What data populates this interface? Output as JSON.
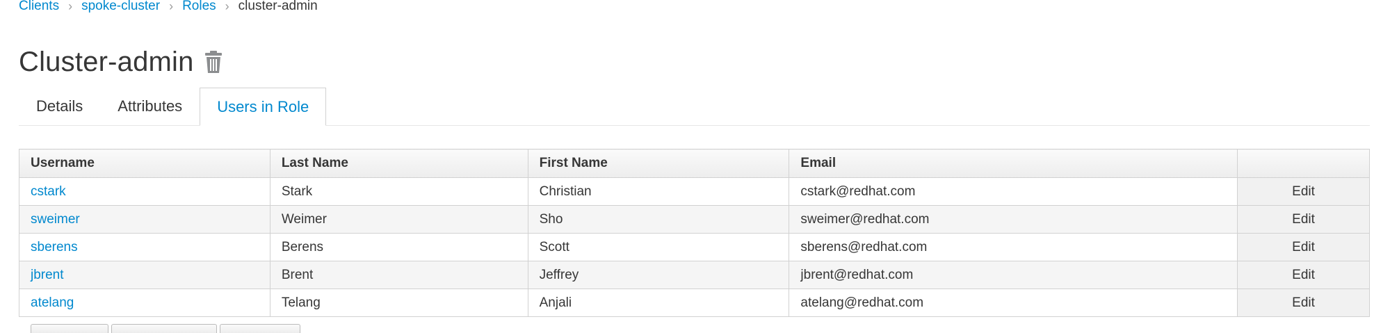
{
  "breadcrumb": {
    "items": [
      "Clients",
      "spoke-cluster",
      "Roles"
    ],
    "current": "cluster-admin",
    "separator": "›"
  },
  "page": {
    "title": "Cluster-admin"
  },
  "tabs": [
    {
      "label": "Details"
    },
    {
      "label": "Attributes"
    },
    {
      "label": "Users in Role"
    }
  ],
  "table": {
    "columns": [
      "Username",
      "Last Name",
      "First Name",
      "Email",
      ""
    ],
    "rows": [
      {
        "username": "cstark",
        "last_name": "Stark",
        "first_name": "Christian",
        "email": "cstark@redhat.com",
        "action": "Edit"
      },
      {
        "username": "sweimer",
        "last_name": "Weimer",
        "first_name": "Sho",
        "email": "sweimer@redhat.com",
        "action": "Edit"
      },
      {
        "username": "sberens",
        "last_name": "Berens",
        "first_name": "Scott",
        "email": "sberens@redhat.com",
        "action": "Edit"
      },
      {
        "username": "jbrent",
        "last_name": "Brent",
        "first_name": "Jeffrey",
        "email": "jbrent@redhat.com",
        "action": "Edit"
      },
      {
        "username": "atelang",
        "last_name": "Telang",
        "first_name": "Anjali",
        "email": "atelang@redhat.com",
        "action": "Edit"
      }
    ]
  },
  "colors": {
    "link": "#0088ce",
    "text": "#363636",
    "border": "#d1d1d1"
  },
  "icons": {
    "delete": "trash-icon",
    "breadcrumb_separator": "chevron-right-icon"
  }
}
